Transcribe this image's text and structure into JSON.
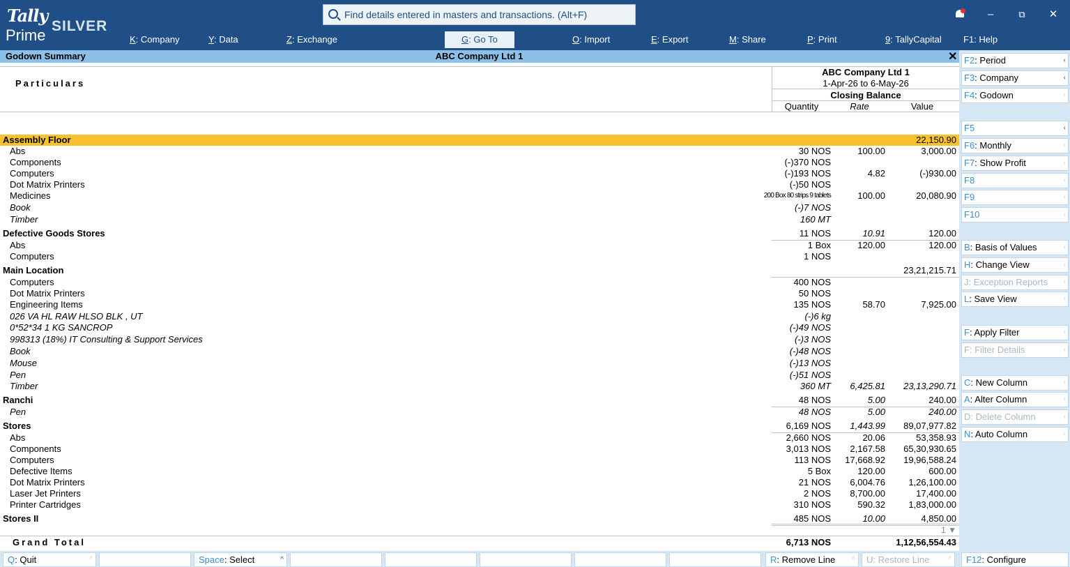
{
  "app": {
    "brand": "Tally",
    "product": "Prime",
    "edition": "SILVER",
    "search_placeholder": "Find details entered in masters and transactions. (Alt+F)"
  },
  "menu": [
    {
      "key": "K",
      "label": "Company"
    },
    {
      "key": "Y",
      "label": "Data"
    },
    {
      "key": "Z",
      "label": "Exchange"
    },
    {
      "key": "G",
      "label": "Go To"
    },
    {
      "key": "O",
      "label": "Import"
    },
    {
      "key": "E",
      "label": "Export"
    },
    {
      "key": "M",
      "label": "Share"
    },
    {
      "key": "P",
      "label": "Print"
    },
    {
      "key": "9",
      "label": "TallyCapital"
    },
    {
      "key": "F1",
      "label": "Help"
    }
  ],
  "window": {
    "minimize": "–",
    "restore": "⧉",
    "close": "✕"
  },
  "titlebar": {
    "report": "Godown Summary",
    "company": "ABC Company Ltd 1",
    "close": "✕"
  },
  "header": {
    "particulars": "Particulars",
    "company": "ABC Company Ltd 1",
    "period": "1-Apr-26 to 6-May-26",
    "closing": "Closing Balance",
    "col_qty": "Quantity",
    "col_rate": "Rate",
    "col_value": "Value"
  },
  "rows": [
    {
      "name": "Assembly Floor",
      "group": true,
      "highlight": true,
      "qty": "",
      "rate": "",
      "value": "22,150.90"
    },
    {
      "name": "Abs",
      "qty": "30 NOS",
      "rate": "100.00",
      "value": "3,000.00"
    },
    {
      "name": "Components",
      "qty": "(-)370 NOS",
      "rate": "",
      "value": ""
    },
    {
      "name": "Computers",
      "qty": "(-)193 NOS",
      "rate": "4.82",
      "value": "(-)930.00"
    },
    {
      "name": "Dot Matrix Printers",
      "qty": "(-)50 NOS",
      "rate": "",
      "value": ""
    },
    {
      "name": "Medicines",
      "qty": "200 Box 80 strips 9 tablets",
      "small": true,
      "rate": "100.00",
      "value": "20,080.90"
    },
    {
      "name": "Book",
      "italic": true,
      "qty": "(-)7 NOS",
      "rate": "",
      "value": ""
    },
    {
      "name": "Timber",
      "italic": true,
      "qty": "160 MT",
      "rate": "",
      "value": ""
    },
    {
      "name": "Defective Goods Stores",
      "group": true,
      "qty": "11 NOS",
      "rate": "10.91",
      "value": "120.00"
    },
    {
      "name": "Abs",
      "qty": "1 Box",
      "rate": "120.00",
      "value": "120.00"
    },
    {
      "name": "Computers",
      "qty": "1 NOS",
      "rate": "",
      "value": ""
    },
    {
      "name": "Main Location",
      "group": true,
      "qty": "",
      "rate": "",
      "value": "23,21,215.71"
    },
    {
      "name": "Computers",
      "qty": "400 NOS",
      "rate": "",
      "value": ""
    },
    {
      "name": "Dot Matrix Printers",
      "qty": "50 NOS",
      "rate": "",
      "value": ""
    },
    {
      "name": "Engineering Items",
      "qty": "135 NOS",
      "rate": "58.70",
      "value": "7,925.00"
    },
    {
      "name": "026 VA HL RAW HLSO BLK , UT",
      "italic": true,
      "qty": "(-)6 kg",
      "rate": "",
      "value": ""
    },
    {
      "name": "0*52*34 1 KG SANCROP",
      "italic": true,
      "qty": "(-)49 NOS",
      "rate": "",
      "value": ""
    },
    {
      "name": "998313 (18%) IT Consulting & Support Services",
      "italic": true,
      "qty": "(-)3 NOS",
      "rate": "",
      "value": ""
    },
    {
      "name": "Book",
      "italic": true,
      "qty": "(-)48 NOS",
      "rate": "",
      "value": ""
    },
    {
      "name": "Mouse",
      "italic": true,
      "qty": "(-)13 NOS",
      "rate": "",
      "value": ""
    },
    {
      "name": "Pen",
      "italic": true,
      "qty": "(-)51 NOS",
      "rate": "",
      "value": ""
    },
    {
      "name": "Timber",
      "italic": true,
      "qty": "360 MT",
      "rate": "6,425.81",
      "value": "23,13,290.71"
    },
    {
      "name": "Ranchi",
      "group": true,
      "qty": "48 NOS",
      "rate": "5.00",
      "value": "240.00"
    },
    {
      "name": "Pen",
      "italic": true,
      "qty": "48 NOS",
      "rate": "5.00",
      "value": "240.00"
    },
    {
      "name": "Stores",
      "group": true,
      "qty": "6,169 NOS",
      "rate": "1,443.99",
      "value": "89,07,977.82"
    },
    {
      "name": "Abs",
      "qty": "2,660 NOS",
      "rate": "20.06",
      "value": "53,358.93"
    },
    {
      "name": "Components",
      "qty": "3,013 NOS",
      "rate": "2,167.58",
      "value": "65,30,930.65"
    },
    {
      "name": "Computers",
      "qty": "113 NOS",
      "rate": "17,668.92",
      "value": "19,96,588.24"
    },
    {
      "name": "Defective Items",
      "qty": "5 Box",
      "rate": "120.00",
      "value": "600.00"
    },
    {
      "name": "Dot Matrix Printers",
      "qty": "21 NOS",
      "rate": "6,004.76",
      "value": "1,26,100.00"
    },
    {
      "name": "Laser Jet Printers",
      "qty": "2 NOS",
      "rate": "8,700.00",
      "value": "17,400.00"
    },
    {
      "name": "Printer Cartridges",
      "qty": "310 NOS",
      "rate": "590.32",
      "value": "1,83,000.00"
    },
    {
      "name": "Stores II",
      "group": true,
      "qty": "485 NOS",
      "rate": "10.00",
      "value": "4,850.00"
    }
  ],
  "page_indicator": "1 ▼",
  "grand_total": {
    "label": "Grand Total",
    "qty": "6,713 NOS",
    "value": "1,12,56,554.43"
  },
  "right_panel": [
    {
      "key": "F2",
      "label": "Period",
      "state": "on"
    },
    {
      "key": "F3",
      "label": "Company",
      "state": "on"
    },
    {
      "key": "F4",
      "label": "Godown",
      "state": "na"
    },
    {
      "key": "F5",
      "label": "",
      "state": "empty-on"
    },
    {
      "key": "F6",
      "label": "Monthly",
      "state": "na"
    },
    {
      "key": "F7",
      "label": "Show Profit",
      "state": "na"
    },
    {
      "key": "F8",
      "label": "",
      "state": "empty"
    },
    {
      "key": "F9",
      "label": "",
      "state": "empty"
    },
    {
      "key": "F10",
      "label": "",
      "state": "empty"
    },
    {
      "key": "B",
      "label": "Basis of Values",
      "state": "na"
    },
    {
      "key": "H",
      "label": "Change View",
      "state": "na"
    },
    {
      "key": "J",
      "label": "Exception Reports",
      "state": "dis"
    },
    {
      "key": "L",
      "label": "Save View",
      "state": "na"
    },
    {
      "key": "F",
      "label": "Apply Filter",
      "state": "na"
    },
    {
      "key": "F",
      "label": "Filter Details",
      "state": "dis"
    },
    {
      "key": "C",
      "label": "New Column",
      "state": "na"
    },
    {
      "key": "A",
      "label": "Alter Column",
      "state": "na"
    },
    {
      "key": "D",
      "label": "Delete Column",
      "state": "dis"
    },
    {
      "key": "N",
      "label": "Auto Column",
      "state": "na"
    }
  ],
  "bottom_bar": [
    {
      "key": "Q",
      "label": "Quit"
    },
    {
      "key": "Space",
      "label": "Select"
    },
    {
      "key": "R",
      "label": "Remove Line"
    },
    {
      "key": "U",
      "label": "Restore Line"
    },
    {
      "key": "F12",
      "label": "Configure"
    }
  ],
  "colors": {
    "topbar": "#1f4f86",
    "titlebar": "#8cc0e8",
    "highlight_row": "#f9c12e",
    "side_panel": "#d5e6f4",
    "key_blue": "#3a8fcf"
  }
}
